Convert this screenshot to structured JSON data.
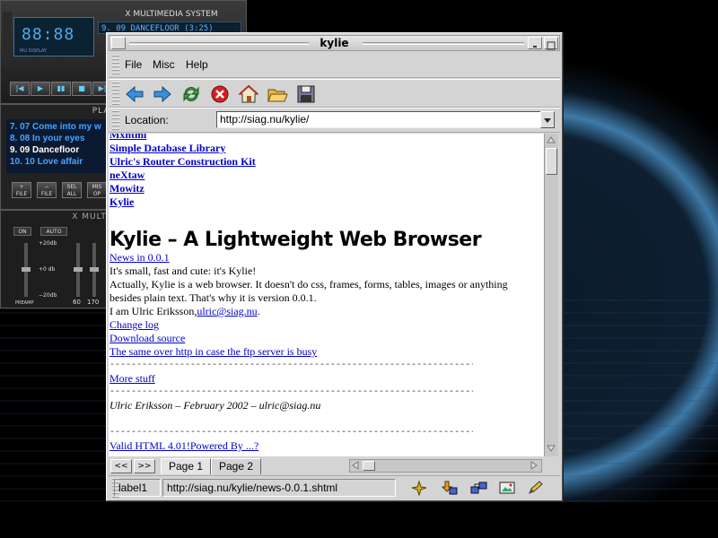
{
  "xmms": {
    "player": {
      "title": "X MULTIMEDIA SYSTEM",
      "time": "88:88",
      "display_label": "MU DISPLAY",
      "scroll_text": "9. 09 DANCEFLOOR (3:25)",
      "controls": [
        "|◀",
        "▶",
        "▮▮",
        "■",
        "▶|"
      ]
    },
    "playlist": {
      "title": "PLAYL",
      "items": [
        {
          "text": "7. 07 Come into my w"
        },
        {
          "text": "8. 08 In your eyes"
        },
        {
          "text": "9. 09 Dancefloor",
          "current": true
        },
        {
          "text": "10. 10 Love affair"
        }
      ],
      "buttons": [
        {
          "top": "+",
          "bottom": "FILE"
        },
        {
          "top": "−",
          "bottom": "FILE"
        },
        {
          "top": "SEL",
          "bottom": "ALL"
        },
        {
          "top": "MIS",
          "bottom": "OP"
        }
      ]
    },
    "equalizer": {
      "title": "X MULTIMEDIA",
      "on": "ON",
      "auto": "AUTO",
      "scale_top": "+20db",
      "scale_mid": "+0 db",
      "scale_bottom": "−20db",
      "preamp": "PREAMP",
      "freq_1": "60",
      "freq_2": "170"
    }
  },
  "browser": {
    "window_title": "kylie",
    "menu": {
      "file": "File",
      "misc": "Misc",
      "help": "Help"
    },
    "toolbar_icons": [
      "back-arrow-icon",
      "forward-arrow-icon",
      "reload-icon",
      "stop-icon",
      "home-icon",
      "open-folder-icon",
      "save-disk-icon"
    ],
    "location": {
      "label": "Location:",
      "url": "http://siag.nu/kylie/"
    },
    "content": {
      "nav_links": [
        "Mxhtml",
        "Simple Database Library",
        "Ulric's Router Construction Kit",
        "neXtaw",
        "Mowitz",
        "Kylie"
      ],
      "heading": "Kylie – A Lightweight Web Browser",
      "news_link": "News in 0.0.1",
      "para1": "It's small, fast and cute: it's Kylie!",
      "para2": "Actually, Kylie is a web browser. It doesn't do css, frames, forms, tables, images or anything besides plain text. That's why it is version 0.0.1.",
      "author_prefix": "I am Ulric Eriksson,",
      "author_link": "ulric@siag.nu",
      "author_suffix": ".",
      "changelog_link": "Change log",
      "download_link": "Download source",
      "mirror_link": "The same over http in case the ftp server is busy",
      "rule": "--------------------------------------------------------------------",
      "more_link": "More stuff",
      "signature": "Ulric Eriksson – February 2002 – ulric@siag.nu",
      "valid_link": "Valid HTML 4.01!Powered By ...?"
    },
    "tabs": {
      "prev": "<<",
      "next": ">>",
      "tab1": "Page 1",
      "tab2": "Page 2"
    },
    "status": {
      "label": "label1",
      "url": "http://siag.nu/kylie/news-0.0.1.shtml"
    }
  },
  "colors": {
    "link": "#0000cc",
    "xmms_text": "#48a3ff",
    "background": "#000000"
  }
}
